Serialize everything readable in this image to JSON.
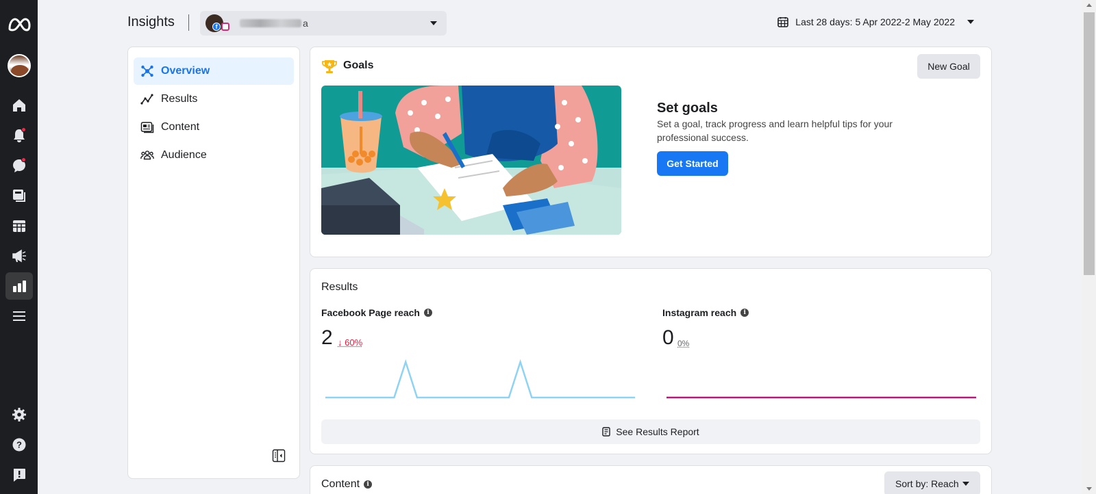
{
  "header": {
    "title": "Insights",
    "page_name_suffix": "a",
    "date_range": "Last 28 days: 5 Apr 2022-2 May 2022"
  },
  "rail": {
    "icons": [
      "meta-logo-icon",
      "profile-avatar",
      "home-icon",
      "notifications-icon",
      "messages-icon",
      "pages-icon",
      "planner-icon",
      "ads-icon",
      "insights-icon",
      "menu-icon",
      "settings-icon",
      "help-icon",
      "feedback-icon"
    ],
    "active": "insights-icon",
    "badge_color": "#f02849"
  },
  "nav": {
    "items": [
      {
        "label": "Overview",
        "icon": "overview-icon",
        "selected": true
      },
      {
        "label": "Results",
        "icon": "results-icon",
        "selected": false
      },
      {
        "label": "Content",
        "icon": "content-icon",
        "selected": false
      },
      {
        "label": "Audience",
        "icon": "audience-icon",
        "selected": false
      }
    ]
  },
  "goals": {
    "title": "Goals",
    "new_goal_label": "New Goal",
    "heading": "Set goals",
    "description": "Set a goal, track progress and learn helpful tips for your professional success.",
    "cta_label": "Get Started"
  },
  "results": {
    "title": "Results",
    "facebook": {
      "label": "Facebook Page reach",
      "value": "2",
      "change": "60%",
      "direction": "down",
      "spark": [
        0,
        0,
        0,
        0,
        0,
        0,
        0,
        1,
        0,
        0,
        0,
        0,
        0,
        0,
        0,
        0,
        0,
        1,
        0,
        0,
        0,
        0,
        0,
        0,
        0,
        0,
        0,
        0
      ],
      "color": "#8fd3f4"
    },
    "instagram": {
      "label": "Instagram reach",
      "value": "0",
      "change": "0%",
      "direction": "flat",
      "spark": [
        0,
        0,
        0,
        0,
        0,
        0,
        0,
        0,
        0,
        0,
        0,
        0,
        0,
        0,
        0,
        0,
        0,
        0,
        0,
        0,
        0,
        0,
        0,
        0,
        0,
        0,
        0,
        0
      ],
      "color": "#b5177a"
    },
    "report_label": "See Results Report"
  },
  "content": {
    "title": "Content",
    "sort_label": "Sort by: Reach"
  },
  "colors": {
    "accent": "#1877f2",
    "nav_selected_bg": "#e7f3ff",
    "rail_bg": "#1c1e21"
  }
}
